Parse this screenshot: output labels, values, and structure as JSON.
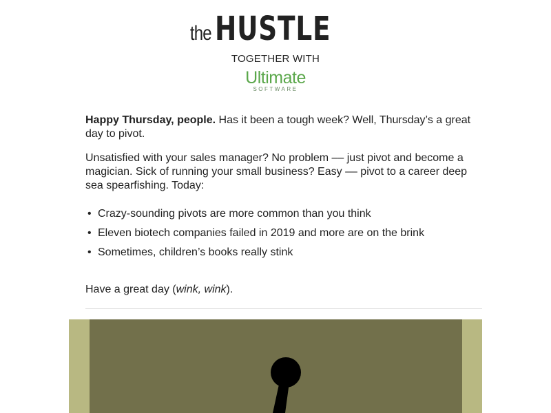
{
  "header": {
    "logo_prefix": "the",
    "logo_word": "HUSTLE",
    "together": "TOGETHER WITH",
    "partner_name": "Ultimate",
    "partner_sub": "SOFTWARE"
  },
  "intro": {
    "greeting_bold": "Happy Thursday, people.",
    "greeting_rest": " Has it been a tough week? Well, Thursday’s a great day to pivot."
  },
  "body_paragraph": "Unsatisfied with your sales manager? No problem –– just pivot and become a magician. Sick of running your small business? Easy –– pivot to a career deep sea spearfishing. Today:",
  "bullets": [
    "Crazy-sounding pivots are more common than you think",
    "Eleven biotech companies failed in 2019 and more are on the brink",
    "Sometimes, children’s books really stink"
  ],
  "bullet_glyph": "•",
  "signoff": {
    "before": "Have a great day (",
    "emphasis": "wink, wink",
    "after": ")."
  },
  "colors": {
    "partner_green": "#5aa74a",
    "hero_outer": "#b8b882",
    "hero_inner": "#72704b",
    "text": "#222222"
  }
}
